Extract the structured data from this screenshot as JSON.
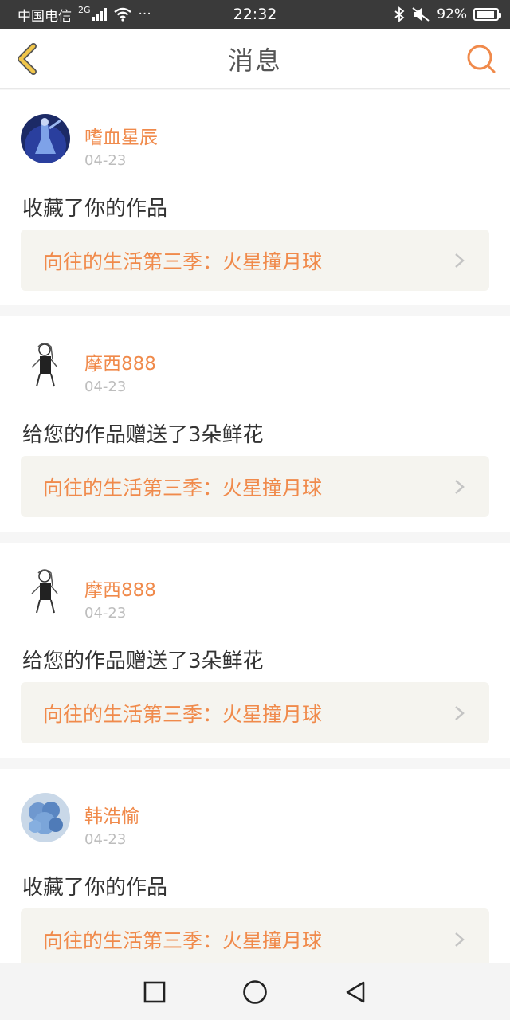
{
  "status_bar": {
    "carrier": "中国电信",
    "network": "2G",
    "dots": "···",
    "time": "22:32",
    "battery": "92%",
    "battery_level": 0.92
  },
  "header": {
    "title": "消息"
  },
  "messages": [
    {
      "name": "嗜血星辰",
      "date": "04-23",
      "text": "收藏了你的作品",
      "work": "向往的生活第三季：火星撞月球",
      "avatar": "blue-figure-avatar"
    },
    {
      "name": "摩西888",
      "date": "04-23",
      "text": "给您的作品赠送了3朵鲜花",
      "work": "向往的生活第三季：火星撞月球",
      "avatar": "sketch-figure-avatar"
    },
    {
      "name": "摩西888",
      "date": "04-23",
      "text": "给您的作品赠送了3朵鲜花",
      "work": "向往的生活第三季：火星撞月球",
      "avatar": "sketch-figure-avatar"
    },
    {
      "name": "韩浩愉",
      "date": "04-23",
      "text": "收藏了你的作品",
      "work": "向往的生活第三季：火星撞月球",
      "avatar": "blue-flowers-avatar"
    }
  ],
  "colors": {
    "accent": "#f08a4b",
    "back_icon": "#f1c64a",
    "card_link_bg": "#f5f4ef"
  }
}
